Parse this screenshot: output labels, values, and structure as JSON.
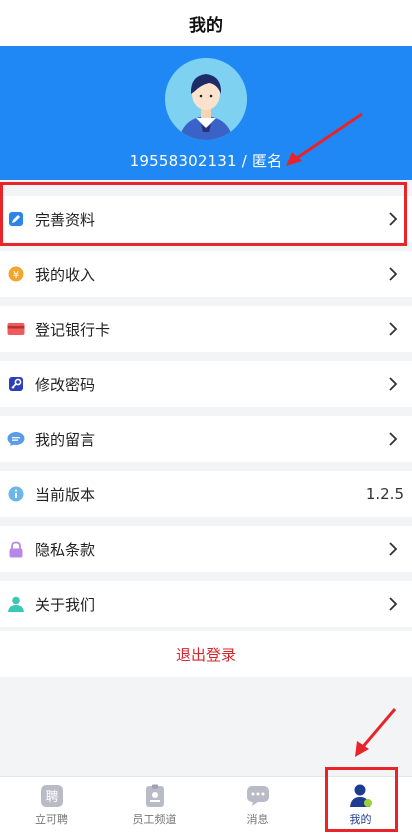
{
  "header": {
    "title": "我的"
  },
  "profile": {
    "phone_name": "19558302131 / 匿名"
  },
  "menu": {
    "items": [
      {
        "label": "完善资料",
        "icon": "edit-icon"
      },
      {
        "label": "我的收入",
        "icon": "yen-coin-icon"
      },
      {
        "label": "登记银行卡",
        "icon": "bank-card-icon"
      },
      {
        "label": "修改密码",
        "icon": "key-icon"
      },
      {
        "label": "我的留言",
        "icon": "message-bubble-icon"
      },
      {
        "label": "当前版本",
        "icon": "info-icon",
        "value": "1.2.5"
      },
      {
        "label": "隐私条款",
        "icon": "lock-icon"
      },
      {
        "label": "关于我们",
        "icon": "person-icon"
      }
    ]
  },
  "logout": {
    "label": "退出登录"
  },
  "tabbar": {
    "tabs": [
      {
        "label": "立可聘",
        "icon": "hire-icon"
      },
      {
        "label": "员工频道",
        "icon": "badge-icon"
      },
      {
        "label": "消息",
        "icon": "chat-icon"
      },
      {
        "label": "我的",
        "icon": "user-icon",
        "active": true
      }
    ]
  },
  "colors": {
    "brand_blue": "#1f88f4",
    "annotation_red": "#e8242a",
    "logout_red": "#d7262b",
    "active_tab": "#1f3b8f"
  }
}
